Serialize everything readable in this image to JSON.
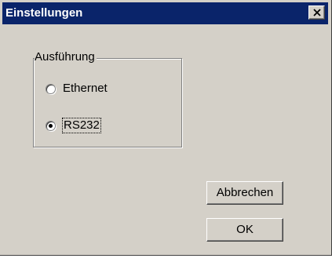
{
  "window": {
    "title": "Einstellungen",
    "close_icon": "close-x-icon"
  },
  "group": {
    "legend": "Ausführung",
    "options": [
      {
        "label": "Ethernet",
        "selected": false
      },
      {
        "label": "RS232",
        "selected": true
      }
    ]
  },
  "buttons": {
    "cancel_label": "Abbrechen",
    "ok_label": "OK"
  },
  "colors": {
    "titlebar": "#0a246a",
    "face": "#d4d0c8"
  }
}
